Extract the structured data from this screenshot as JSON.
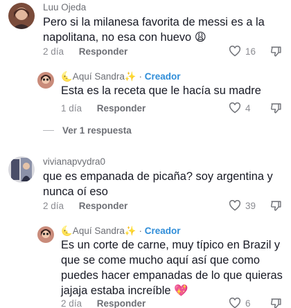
{
  "comments": [
    {
      "author": "Luu Ojeda",
      "text": "Pero si la milanesa favorita de messi es a la napolitana, no esa con huevo 😩",
      "time": "2 día",
      "reply_label": "Responder",
      "likes": "16"
    },
    {
      "author": "🌜Aquí Sandra✨",
      "creator_sep": "·",
      "creator_label": "Creador",
      "text": "Esta es la receta que le hacía su madre",
      "time": "1 día",
      "reply_label": "Responder",
      "likes": "4"
    },
    {
      "author": "vivianapvydra0",
      "text": "que es empanada de picaña? soy argentina y nunca oí eso",
      "time": "2 día",
      "reply_label": "Responder",
      "likes": "39"
    },
    {
      "author": "🌜Aquí Sandra✨",
      "creator_sep": "·",
      "creator_label": "Creador",
      "text": "Es un corte de carne, muy típico en Brazil y que se come mucho aquí así que como puedes hacer empanadas de lo que quieras jajaja estaba increíble 💖",
      "time": "2 día",
      "reply_label": "Responder",
      "likes": "6"
    }
  ],
  "view_replies_label": "Ver 1 respuesta",
  "colors": {
    "creator": "#2f8dd8",
    "meta": "#8a8b91",
    "text": "#161823"
  },
  "icons": [
    "heart-outline-icon",
    "thumbs-down-icon"
  ]
}
